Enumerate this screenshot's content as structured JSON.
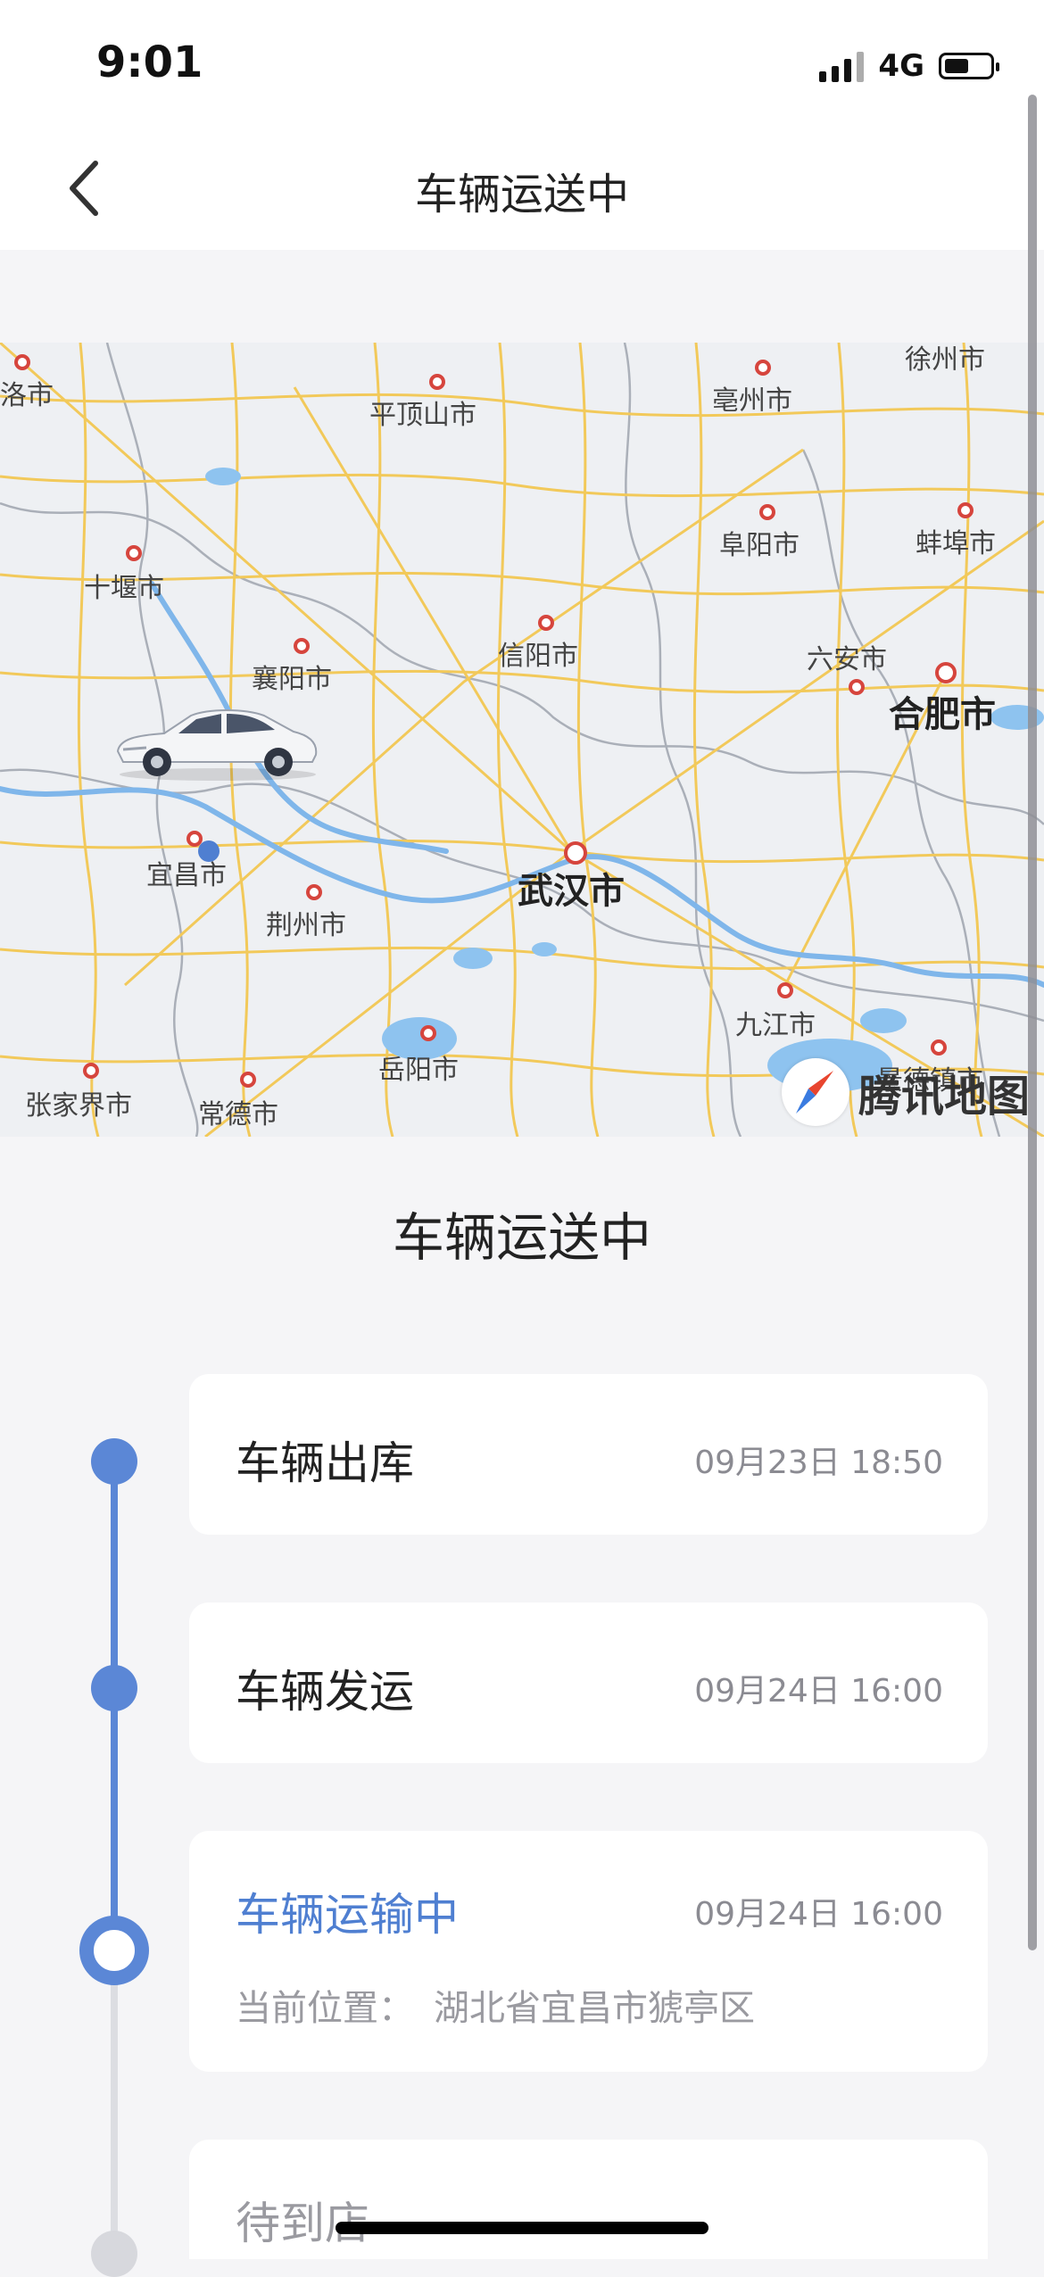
{
  "status_bar": {
    "time": "9:01",
    "network": "4G"
  },
  "nav": {
    "title": "车辆运送中",
    "back_icon": "chevron-left-icon"
  },
  "map": {
    "cities": [
      {
        "name": "洛市"
      },
      {
        "name": "平顶山市"
      },
      {
        "name": "亳州市"
      },
      {
        "name": "徐州市"
      },
      {
        "name": "阜阳市"
      },
      {
        "name": "蚌埠市"
      },
      {
        "name": "十堰市"
      },
      {
        "name": "襄阳市"
      },
      {
        "name": "信阳市"
      },
      {
        "name": "六安市"
      },
      {
        "name": "合肥市"
      },
      {
        "name": "宜昌市"
      },
      {
        "name": "武汉市"
      },
      {
        "name": "荆州市"
      },
      {
        "name": "九江市"
      },
      {
        "name": "岳阳市"
      },
      {
        "name": "张家界市"
      },
      {
        "name": "常德市"
      },
      {
        "name": "景德镇市"
      }
    ],
    "brand": "腾讯地图",
    "vehicle_icon": "car-icon"
  },
  "section_title": "车辆运送中",
  "timeline": [
    {
      "title": "车辆出库",
      "time": "09月23日 18:50",
      "state": "done"
    },
    {
      "title": "车辆发运",
      "time": "09月24日 16:00",
      "state": "done"
    },
    {
      "title": "车辆运输中",
      "time": "09月24日 16:00",
      "state": "current",
      "location_label": "当前位置：",
      "location_value": "湖北省宜昌市猇亭区"
    },
    {
      "title": "待到店",
      "time": "",
      "state": "pending"
    }
  ],
  "colors": {
    "accent": "#5b87d6",
    "active_text": "#4f7fd1",
    "background": "#f5f5f7",
    "card": "#ffffff",
    "inactive_line": "#dcdde2"
  }
}
